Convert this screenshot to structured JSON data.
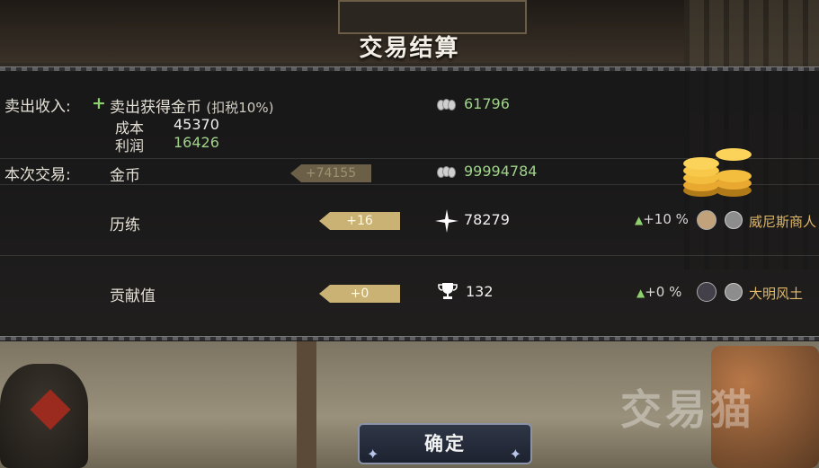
{
  "title": "交易结算",
  "income": {
    "label": "卖出收入:",
    "plus": "+",
    "desc": "卖出获得金币",
    "tax_note": "(扣税10%)",
    "value": "61796",
    "cost_label": "成本",
    "cost_value": "45370",
    "profit_label": "利润",
    "profit_value": "16426"
  },
  "trade": {
    "label": "本次交易:",
    "gold": {
      "name": "金币",
      "change": "+74155",
      "total": "99994784"
    },
    "experience": {
      "name": "历练",
      "change": "+16",
      "total": "78279",
      "bonus": "+10 %",
      "faction": "威尼斯商人"
    },
    "contribution": {
      "name": "贡献值",
      "change": "+0",
      "total": "132",
      "bonus": "+0 %",
      "faction": "大明风土"
    }
  },
  "confirm_label": "确定",
  "watermark": "交易猫",
  "colors": {
    "profit": "#9fd38a",
    "tag_gold": "#c9b273",
    "faction": "#e0b866"
  },
  "icons": [
    "coin-stack-icon",
    "star-burst-icon",
    "trophy-icon",
    "gold-pile-icon"
  ]
}
